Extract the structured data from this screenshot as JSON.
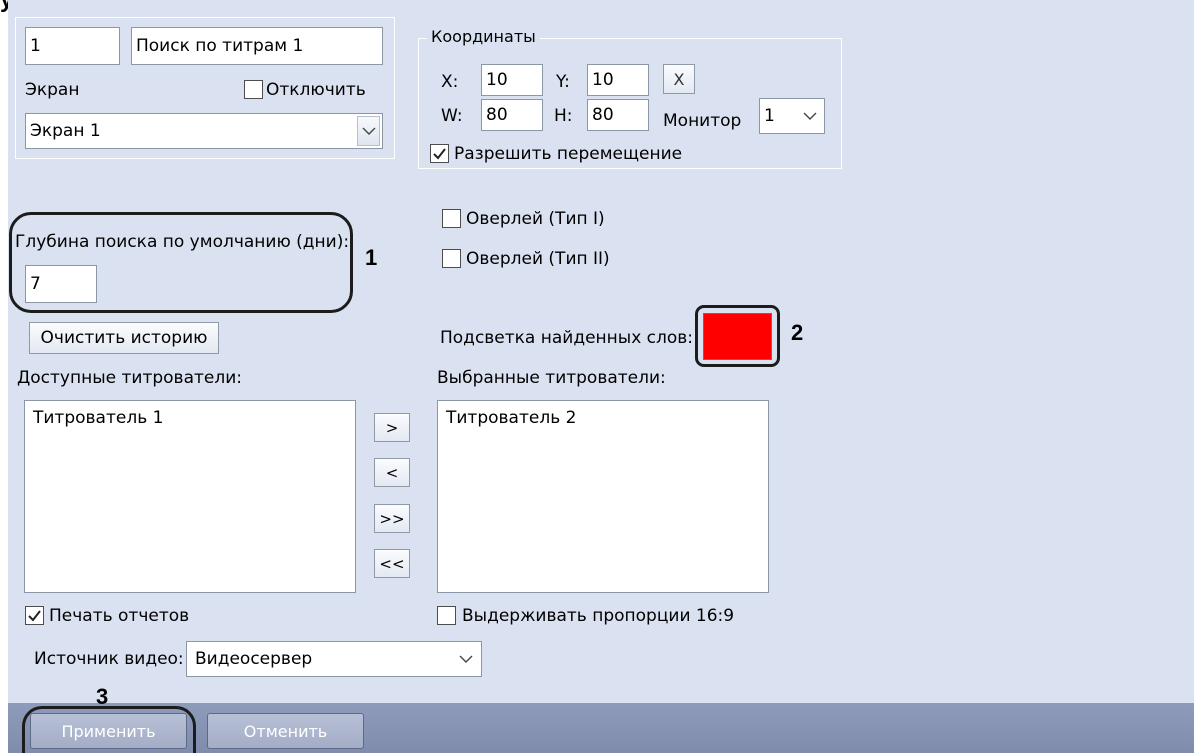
{
  "header_fragment": "у",
  "camera": {
    "id": "1",
    "name": "Поиск по титрам 1",
    "screen_label": "Экран",
    "disable_label": "Отключить",
    "disable_checked": false,
    "screen_value": "Экран 1"
  },
  "coordinates": {
    "legend": "Координаты",
    "x_label": "X:",
    "x_value": "10",
    "y_label": "Y:",
    "y_value": "10",
    "reset_glyph": "X",
    "w_label": "W:",
    "w_value": "80",
    "h_label": "H:",
    "h_value": "80",
    "monitor_label": "Монитор",
    "monitor_value": "1",
    "allow_move_label": "Разрешить перемещение",
    "allow_move_checked": true
  },
  "search": {
    "depth_label": "Глубина поиска по умолчанию (дни):",
    "depth_value": "7",
    "clear_history_label": "Очистить историю"
  },
  "overlays": {
    "type1_label": "Оверлей (Тип I)",
    "type2_label": "Оверлей (Тип II)"
  },
  "highlight": {
    "label": "Подсветка найденных слов:",
    "color": "#ff0000"
  },
  "titlers": {
    "available_label": "Доступные титрователи:",
    "available": [
      "Титрователь 1"
    ],
    "selected_label": "Выбранные титрователи:",
    "selected": [
      "Титрователь 2"
    ],
    "move_right": ">",
    "move_left": "<",
    "move_all_right": ">>",
    "move_all_left": "<<"
  },
  "options": {
    "print_reports_label": "Печать отчетов",
    "print_reports_checked": true,
    "keep_ratio_label": "Выдерживать пропорции 16:9",
    "keep_ratio_checked": false
  },
  "video_source": {
    "label": "Источник видео:",
    "value": "Видеосервер"
  },
  "footer": {
    "apply_label": "Применить",
    "cancel_label": "Отменить"
  },
  "annotations": {
    "n1": "1",
    "n2": "2",
    "n3": "3"
  },
  "colors": {
    "panel_bg": "#dae2f1",
    "footer_bg": "#8492b0",
    "annotation_outline": "#1c1c1c"
  }
}
